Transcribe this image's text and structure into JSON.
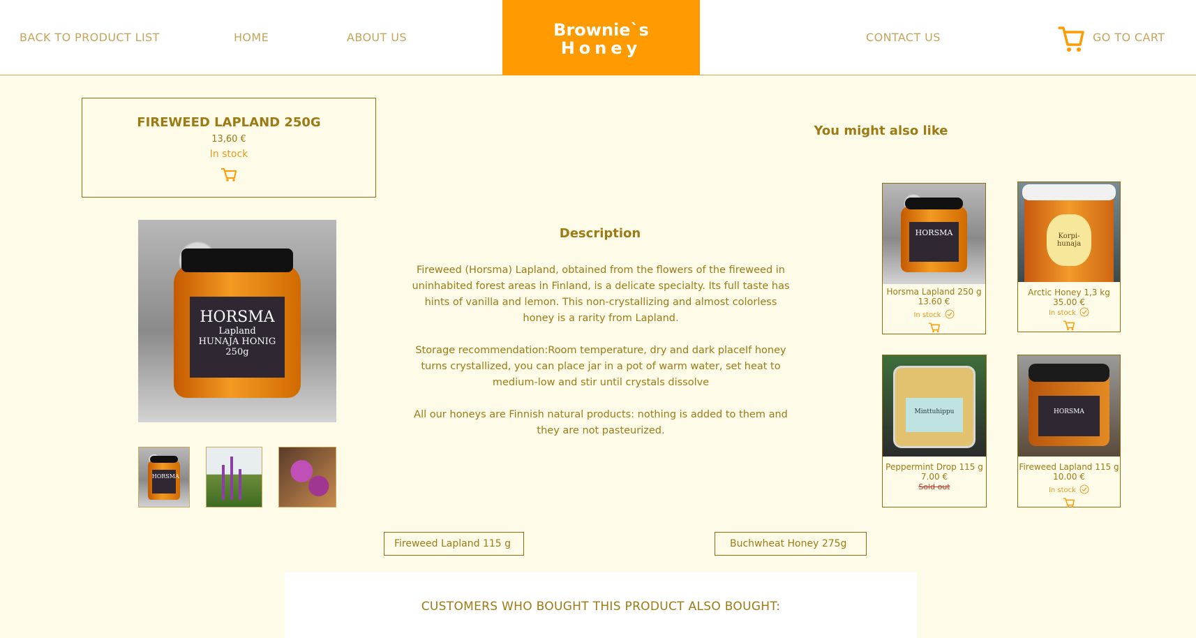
{
  "header": {
    "back_link": "BACK TO  PRODUCT LIST",
    "home_link": "HOME",
    "about_link": "ABOUT US",
    "brand_line1": "Brownie`s",
    "brand_line2": "Honey",
    "contact_link": "CONTACT US",
    "cart_link": "GO TO CART",
    "cart_icon": "shopping-cart-icon"
  },
  "product": {
    "title": "FIREWEED LAPLAND 250G",
    "price": "13,60 €",
    "stock": "In stock",
    "main_image_label": "HORSMA",
    "main_image_sub": "Lapland",
    "main_image_small": "HUNAJA HONIG 250g",
    "thumb_label": "HORSMA"
  },
  "description": {
    "title": "Description",
    "paragraph1": "Fireweed (Horsma) Lapland, obtained from the flowers of the fireweed in uninhabited forest areas in Finland, is a delicate specialty. Its full taste has hints of vanilla and lemon. This non-crystallizing and almost colorless honey is a rarity from Lapland.",
    "paragraph2": "Storage recommendation:Room temperature, dry and dark placeIf honey turns crystallized, you can place jar in a pot of warm water, set heat to medium-low and stir until crystals dissolve",
    "paragraph3": "All our honeys are Finnish natural products: nothing is added to them and they are not pasteurized."
  },
  "suggestions": {
    "title": "You might also like",
    "items": [
      {
        "name": "Horsma Lapland 250 g",
        "price": "13.60 €",
        "stock": "In stock",
        "image_label": "HORSMA"
      },
      {
        "name": "Arctic Honey 1,3 kg",
        "price": "35.00 €",
        "stock": "In stock",
        "image_label": "Korpi-hunaja"
      },
      {
        "name": "Peppermint Drop 115 g",
        "price": "7.00 €",
        "stock": "Sold out",
        "image_label": "Minttuhippu"
      },
      {
        "name": "Fireweed Lapland 115 g",
        "price": "10.00 €",
        "stock": "In stock",
        "image_label": "HORSMA"
      }
    ]
  },
  "pager": {
    "prev": "Fireweed Lapland 115 g",
    "next": "Buchwheat Honey 275g"
  },
  "also_bought": {
    "title": "CUSTOMERS WHO BOUGHT THIS PRODUCT ALSO BOUGHT:"
  },
  "colors": {
    "brand_orange": "#ff9a00",
    "text_gold": "#9c7a14",
    "stock_orange": "#e79a1e",
    "background": "#fefbe8"
  }
}
